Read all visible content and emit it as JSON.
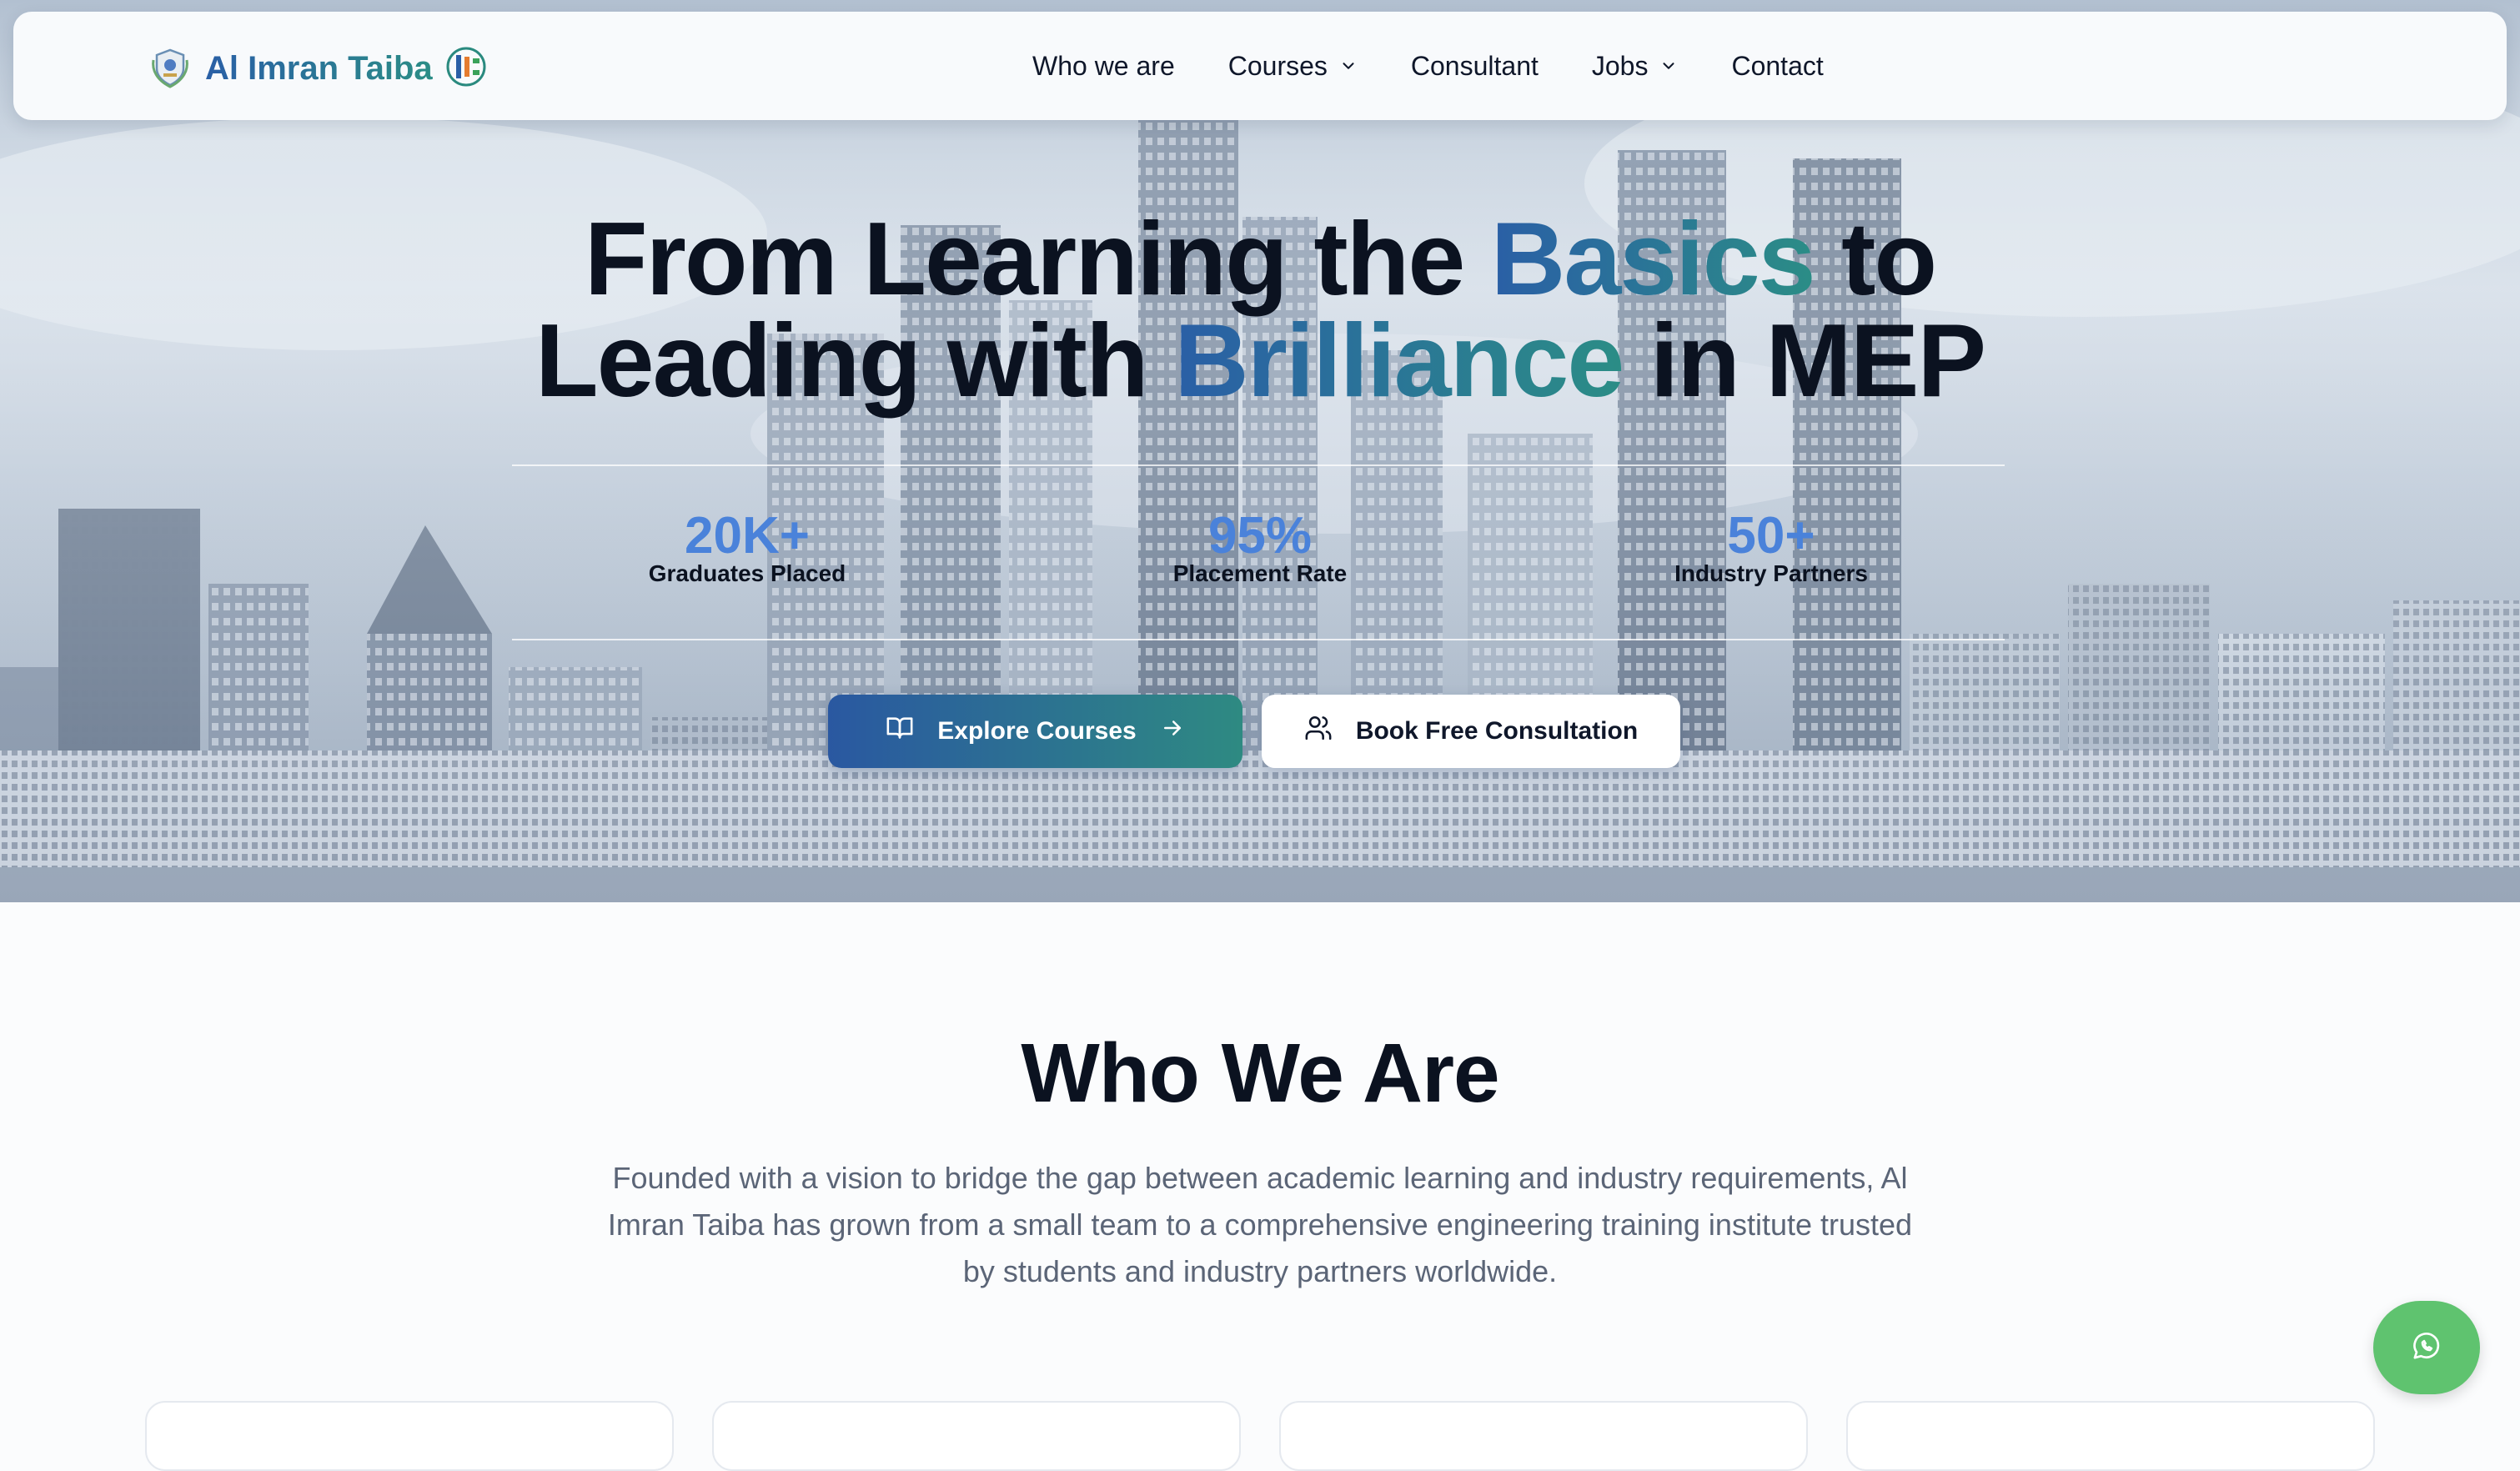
{
  "nav": {
    "brand": "Al Imran Taiba",
    "links": [
      {
        "label": "Who we are",
        "has_dropdown": false
      },
      {
        "label": "Courses",
        "has_dropdown": true
      },
      {
        "label": "Consultant",
        "has_dropdown": false
      },
      {
        "label": "Jobs",
        "has_dropdown": true
      },
      {
        "label": "Contact",
        "has_dropdown": false
      }
    ]
  },
  "hero": {
    "line1_a": "From Learning the ",
    "line1_highlight": "Basics",
    "line1_b": " to",
    "line2_a": "Leading with ",
    "line2_highlight": "Brilliance",
    "line2_b": " in MEP",
    "stats": [
      {
        "value": "20K+",
        "label": "Graduates Placed"
      },
      {
        "value": "95%",
        "label": "Placement Rate"
      },
      {
        "value": "50+",
        "label": "Industry Partners"
      }
    ],
    "primary_cta": "Explore Courses",
    "secondary_cta": "Book Free Consultation"
  },
  "who": {
    "title": "Who We Are",
    "body": "Founded with a vision to bridge the gap between academic learning and industry requirements, Al Imran Taiba has grown from a small team to a comprehensive engineering training institute trusted by students and industry partners worldwide."
  },
  "icons": {
    "brand_seal": "crest-logo-icon",
    "brand_mark": "monogram-logo-icon",
    "dropdown": "chevron-down-icon",
    "explore": "book-open-icon",
    "arrow": "arrow-right-icon",
    "consult": "users-icon",
    "chat": "whatsapp-icon"
  },
  "colors": {
    "brand_blue": "#2a5fa6",
    "brand_teal": "#2b8d86",
    "stat_blue": "#4a82da",
    "whatsapp_green": "#5fc36f"
  }
}
